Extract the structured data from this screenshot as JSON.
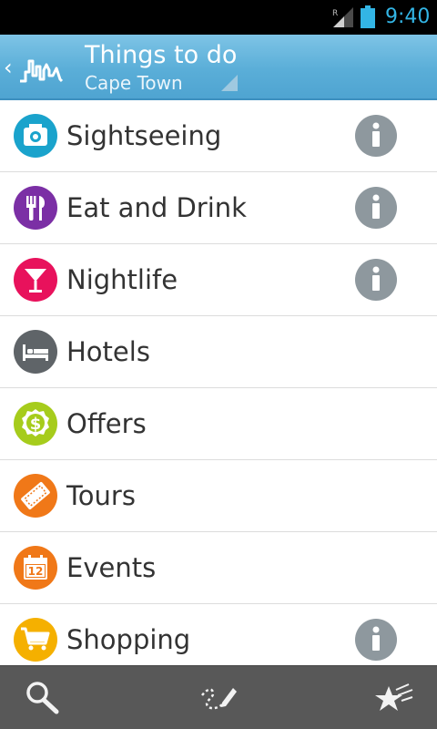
{
  "status_bar": {
    "time": "9:40",
    "signal_icon": "signal-roaming-icon",
    "battery_icon": "battery-icon"
  },
  "action_bar": {
    "up_icon": "chevron-left-icon",
    "logo_icon": "city-skyline-logo-icon",
    "title": "Things to do",
    "subtitle": "Cape Town",
    "spinner_icon": "dropdown-triangle-icon"
  },
  "categories": [
    {
      "label": "Sightseeing",
      "icon": "camera-icon",
      "color": "#1aa3cc",
      "has_info": true
    },
    {
      "label": "Eat and Drink",
      "icon": "fork-knife-icon",
      "color": "#7b2fa5",
      "has_info": true
    },
    {
      "label": "Nightlife",
      "icon": "cocktail-glass-icon",
      "color": "#e8125c",
      "has_info": true
    },
    {
      "label": "Hotels",
      "icon": "bed-icon",
      "color": "#5f6468",
      "has_info": false
    },
    {
      "label": "Offers",
      "icon": "dollar-badge-icon",
      "color": "#a6cc1c",
      "has_info": false
    },
    {
      "label": "Tours",
      "icon": "ticket-icon",
      "color": "#f07818",
      "has_info": false
    },
    {
      "label": "Events",
      "icon": "calendar-icon",
      "color": "#f07818",
      "has_info": false
    },
    {
      "label": "Shopping",
      "icon": "shopping-cart-icon",
      "color": "#f5b000",
      "has_info": true
    }
  ],
  "info_icon": "info-icon",
  "bottom_bar": {
    "buttons": [
      {
        "icon": "search-icon"
      },
      {
        "icon": "pencil-route-icon"
      },
      {
        "icon": "favorites-stars-icon"
      }
    ]
  }
}
